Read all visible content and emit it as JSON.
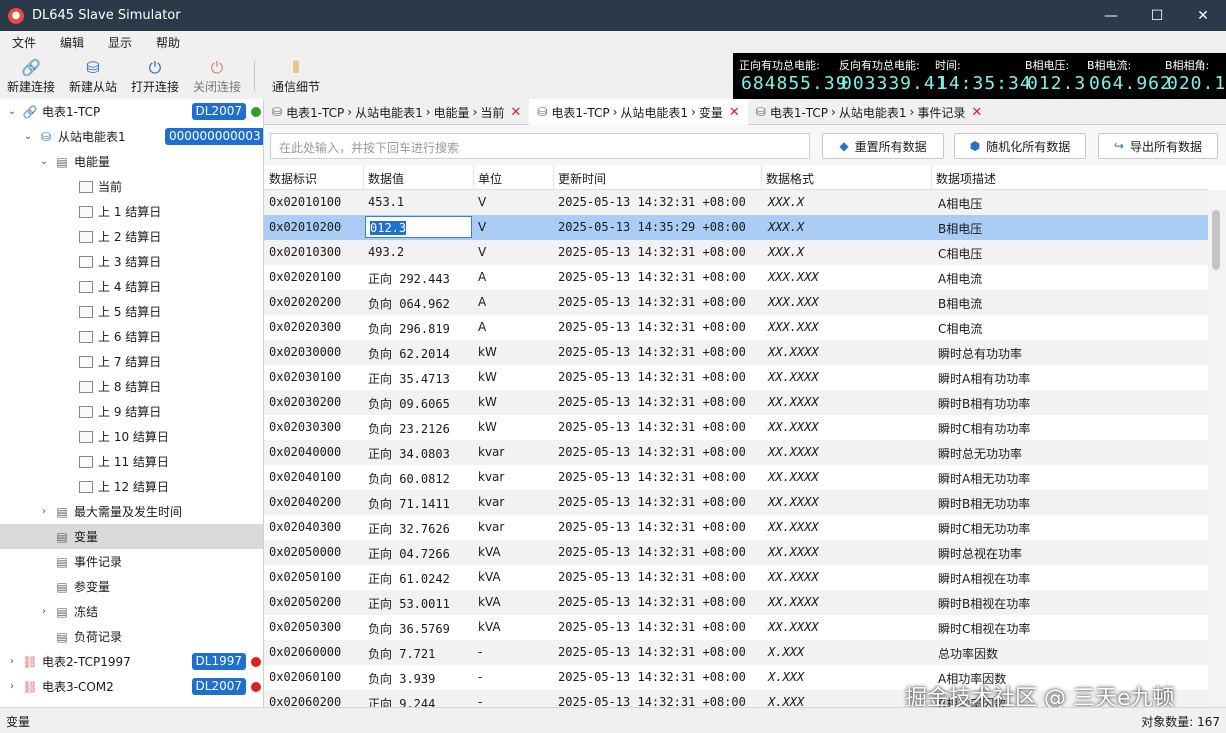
{
  "window": {
    "title": "DL645 Slave Simulator",
    "minimize": "—",
    "maximize": "☐",
    "close": "✕"
  },
  "menu": [
    "文件",
    "编辑",
    "显示",
    "帮助"
  ],
  "toolbar": [
    {
      "label": "新建连接",
      "icon": "link-icon",
      "enabled": true
    },
    {
      "label": "新建从站",
      "icon": "database-icon",
      "enabled": true
    },
    {
      "label": "打开连接",
      "icon": "power-icon",
      "enabled": true
    },
    {
      "label": "关闭连接",
      "icon": "power-icon",
      "enabled": false
    },
    {
      "label": "通信细节",
      "icon": "columns-icon",
      "enabled": true
    }
  ],
  "lcd": [
    {
      "label": "正向有功总电能:",
      "value": "684855.39"
    },
    {
      "label": "反向有功总电能:",
      "value": "003339.41"
    },
    {
      "label": "时间:",
      "value": "14:35:34"
    },
    {
      "label": "B相电压:",
      "value": "012.3"
    },
    {
      "label": "B相电流:",
      "value": "064.962"
    },
    {
      "label": "B相相角:",
      "value": "020.1"
    }
  ],
  "tree": [
    {
      "label": "电表1-TCP",
      "level": 0,
      "expanded": true,
      "icon": "link-icon",
      "badge": "DL2007",
      "status": "#2e9e2e"
    },
    {
      "label": "从站电能表1",
      "level": 1,
      "expanded": true,
      "icon": "database-icon",
      "badge": "000000000003"
    },
    {
      "label": "电能量",
      "level": 2,
      "expanded": true,
      "icon": "folder-db-icon"
    },
    {
      "label": "当前",
      "level": 3,
      "icon": "doc-icon"
    },
    {
      "label": "上 1 结算日",
      "level": 3,
      "icon": "doc-icon"
    },
    {
      "label": "上 2 结算日",
      "level": 3,
      "icon": "doc-icon"
    },
    {
      "label": "上 3 结算日",
      "level": 3,
      "icon": "doc-icon"
    },
    {
      "label": "上 4 结算日",
      "level": 3,
      "icon": "doc-icon"
    },
    {
      "label": "上 5 结算日",
      "level": 3,
      "icon": "doc-icon"
    },
    {
      "label": "上 6 结算日",
      "level": 3,
      "icon": "doc-icon"
    },
    {
      "label": "上 7 结算日",
      "level": 3,
      "icon": "doc-icon"
    },
    {
      "label": "上 8 结算日",
      "level": 3,
      "icon": "doc-icon"
    },
    {
      "label": "上 9 结算日",
      "level": 3,
      "icon": "doc-icon"
    },
    {
      "label": "上 10 结算日",
      "level": 3,
      "icon": "doc-icon"
    },
    {
      "label": "上 11 结算日",
      "level": 3,
      "icon": "doc-icon"
    },
    {
      "label": "上 12 结算日",
      "level": 3,
      "icon": "doc-icon"
    },
    {
      "label": "最大需量及发生时间",
      "level": 2,
      "collapsed": true,
      "icon": "folder-db-icon"
    },
    {
      "label": "变量",
      "level": 2,
      "icon": "folder-db-icon",
      "selected": true
    },
    {
      "label": "事件记录",
      "level": 2,
      "icon": "folder-db-icon"
    },
    {
      "label": "参变量",
      "level": 2,
      "icon": "folder-db-icon"
    },
    {
      "label": "冻结",
      "level": 2,
      "collapsed": true,
      "icon": "folder-db-icon"
    },
    {
      "label": "负荷记录",
      "level": 2,
      "icon": "folder-db-icon"
    },
    {
      "label": "电表2-TCP1997",
      "level": 0,
      "collapsed": true,
      "icon": "link-off-icon",
      "badge": "DL1997",
      "status": "#e02020"
    },
    {
      "label": "电表3-COM2",
      "level": 0,
      "collapsed": true,
      "icon": "link-off-icon",
      "badge": "DL2007",
      "status": "#e02020"
    }
  ],
  "tabs": [
    {
      "crumbs": [
        "电表1-TCP",
        "从站电能表1",
        "电能量",
        "当前"
      ],
      "active": false
    },
    {
      "crumbs": [
        "电表1-TCP",
        "从站电能表1",
        "变量"
      ],
      "active": true
    },
    {
      "crumbs": [
        "电表1-TCP",
        "从站电能表1",
        "事件记录"
      ],
      "active": false
    }
  ],
  "search": {
    "placeholder": "在此处输入，并按下回车进行搜索"
  },
  "actions": [
    {
      "label": "重置所有数据",
      "icon": "eraser-icon"
    },
    {
      "label": "随机化所有数据",
      "icon": "cube-icon"
    },
    {
      "label": "导出所有数据",
      "icon": "export-icon"
    }
  ],
  "columns": [
    "数据标识",
    "数据值",
    "单位",
    "更新时间",
    "数据格式",
    "数据项描述"
  ],
  "rows": [
    [
      "0x02010100",
      "453.1",
      "V",
      "2025-05-13 14:32:31 +08:00",
      "XXX.X",
      "A相电压"
    ],
    [
      "0x02010200",
      "012.3",
      "V",
      "2025-05-13 14:35:29 +08:00",
      "XXX.X",
      "B相电压"
    ],
    [
      "0x02010300",
      "493.2",
      "V",
      "2025-05-13 14:32:31 +08:00",
      "XXX.X",
      "C相电压"
    ],
    [
      "0x02020100",
      "正向 292.443",
      "A",
      "2025-05-13 14:32:31 +08:00",
      "XXX.XXX",
      "A相电流"
    ],
    [
      "0x02020200",
      "负向 064.962",
      "A",
      "2025-05-13 14:32:31 +08:00",
      "XXX.XXX",
      "B相电流"
    ],
    [
      "0x02020300",
      "负向 296.819",
      "A",
      "2025-05-13 14:32:31 +08:00",
      "XXX.XXX",
      "C相电流"
    ],
    [
      "0x02030000",
      "负向 62.2014",
      "kW",
      "2025-05-13 14:32:31 +08:00",
      "XX.XXXX",
      "瞬时总有功功率"
    ],
    [
      "0x02030100",
      "正向 35.4713",
      "kW",
      "2025-05-13 14:32:31 +08:00",
      "XX.XXXX",
      "瞬时A相有功功率"
    ],
    [
      "0x02030200",
      "负向 09.6065",
      "kW",
      "2025-05-13 14:32:31 +08:00",
      "XX.XXXX",
      "瞬时B相有功功率"
    ],
    [
      "0x02030300",
      "负向 23.2126",
      "kW",
      "2025-05-13 14:32:31 +08:00",
      "XX.XXXX",
      "瞬时C相有功功率"
    ],
    [
      "0x02040000",
      "正向 34.0803",
      "kvar",
      "2025-05-13 14:32:31 +08:00",
      "XX.XXXX",
      "瞬时总无功功率"
    ],
    [
      "0x02040100",
      "负向 60.0812",
      "kvar",
      "2025-05-13 14:32:31 +08:00",
      "XX.XXXX",
      "瞬时A相无功功率"
    ],
    [
      "0x02040200",
      "负向 71.1411",
      "kvar",
      "2025-05-13 14:32:31 +08:00",
      "XX.XXXX",
      "瞬时B相无功功率"
    ],
    [
      "0x02040300",
      "正向 32.7626",
      "kvar",
      "2025-05-13 14:32:31 +08:00",
      "XX.XXXX",
      "瞬时C相无功功率"
    ],
    [
      "0x02050000",
      "正向 04.7266",
      "kVA",
      "2025-05-13 14:32:31 +08:00",
      "XX.XXXX",
      "瞬时总视在功率"
    ],
    [
      "0x02050100",
      "正向 61.0242",
      "kVA",
      "2025-05-13 14:32:31 +08:00",
      "XX.XXXX",
      "瞬时A相视在功率"
    ],
    [
      "0x02050200",
      "正向 53.0011",
      "kVA",
      "2025-05-13 14:32:31 +08:00",
      "XX.XXXX",
      "瞬时B相视在功率"
    ],
    [
      "0x02050300",
      "负向 36.5769",
      "kVA",
      "2025-05-13 14:32:31 +08:00",
      "XX.XXXX",
      "瞬时C相视在功率"
    ],
    [
      "0x02060000",
      "负向 7.721",
      "-",
      "2025-05-13 14:32:31 +08:00",
      "X.XXX",
      "总功率因数"
    ],
    [
      "0x02060100",
      "负向 3.939",
      "-",
      "2025-05-13 14:32:31 +08:00",
      "X.XXX",
      "A相功率因数"
    ],
    [
      "0x02060200",
      "正向 9.244",
      "-",
      "2025-05-13 14:32:31 +08:00",
      "X.XXX",
      "B相功率因数"
    ]
  ],
  "selected_row": 1,
  "status": {
    "left": "变量",
    "right": "对象数量:  167"
  },
  "watermark": "掘金技术社区 @ 三天e九顿"
}
